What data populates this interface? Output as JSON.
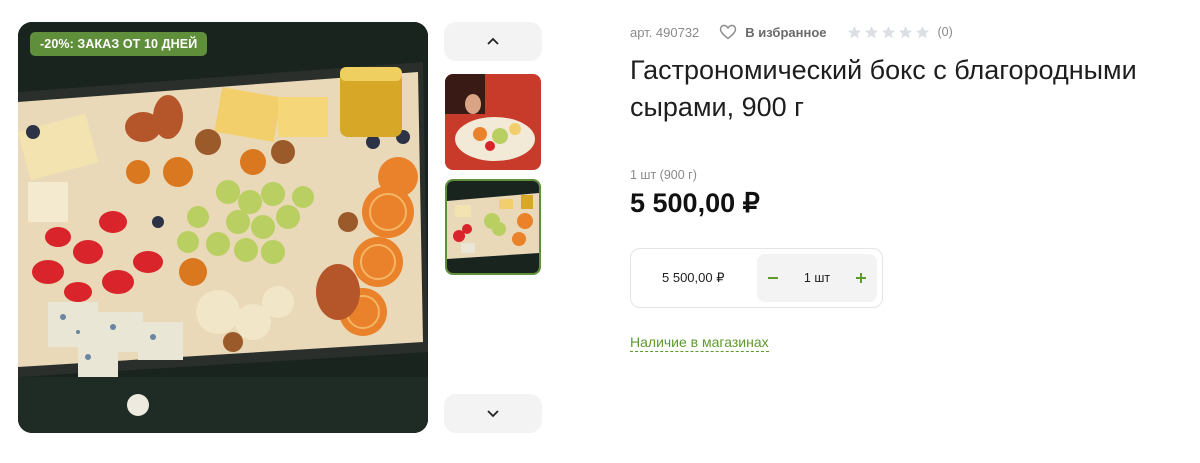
{
  "gallery": {
    "promo_badge": "-20%: ЗАКАЗ ОТ 10 ДНЕЙ",
    "main_image": "cheese-platter-photo",
    "thumbnails": [
      {
        "name": "thumb-serving-photo",
        "selected": false
      },
      {
        "name": "thumb-platter-photo",
        "selected": true
      }
    ],
    "icons": {
      "up": "chevron-up-icon",
      "down": "chevron-down-icon"
    }
  },
  "product": {
    "sku": "арт. 490732",
    "favorite_label": "В избранное",
    "rating": 0,
    "reviews": "(0)",
    "title": "Гастрономический бокс с благородными сырами, 900 г",
    "unit_note": "1 шт (900 г)",
    "price": "5 500,00 ₽"
  },
  "cart": {
    "price": "5 500,00 ₽",
    "quantity": "1 шт",
    "minus_icon": "minus-icon",
    "plus_icon": "plus-icon"
  },
  "availability_link": "Наличие в магазинах",
  "colors": {
    "accent": "#5f9a2f",
    "badge": "#5f8f3a",
    "button_bg": "#f3f3f3"
  }
}
